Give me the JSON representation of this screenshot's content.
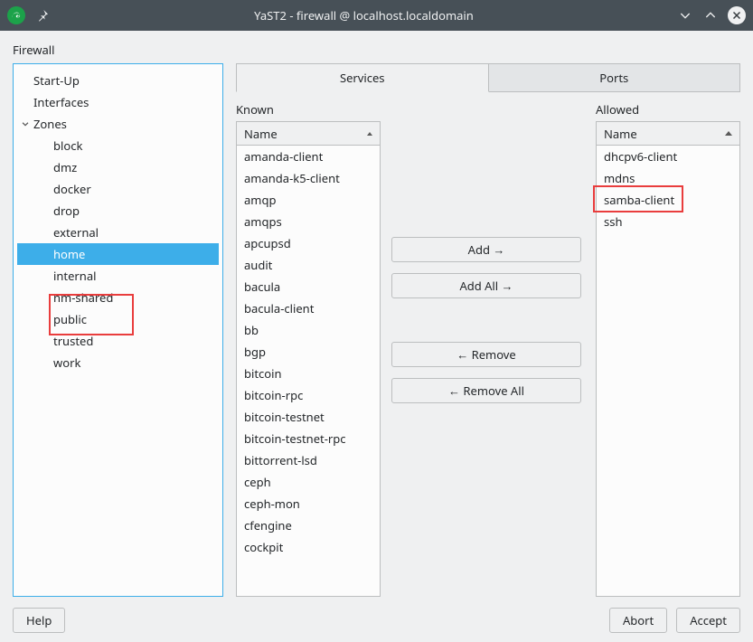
{
  "window": {
    "title": "YaST2 ‑ firewall @ localhost.localdomain"
  },
  "section_label": "Firewall",
  "tree": {
    "items": [
      {
        "label": "Start-Up",
        "level": 0
      },
      {
        "label": "Interfaces",
        "level": 0
      },
      {
        "label": "Zones",
        "level": 0,
        "expanded": true,
        "children": [
          {
            "label": "block"
          },
          {
            "label": "dmz"
          },
          {
            "label": "docker"
          },
          {
            "label": "drop"
          },
          {
            "label": "external"
          },
          {
            "label": "home",
            "selected": true
          },
          {
            "label": "internal"
          },
          {
            "label": "nm-shared"
          },
          {
            "label": "public"
          },
          {
            "label": "trusted"
          },
          {
            "label": "work"
          }
        ]
      }
    ]
  },
  "tabs": {
    "services": "Services",
    "ports": "Ports",
    "active": "services"
  },
  "known": {
    "label": "Known",
    "header": "Name",
    "items": [
      "amanda-client",
      "amanda-k5-client",
      "amqp",
      "amqps",
      "apcupsd",
      "audit",
      "bacula",
      "bacula-client",
      "bb",
      "bgp",
      "bitcoin",
      "bitcoin-rpc",
      "bitcoin-testnet",
      "bitcoin-testnet-rpc",
      "bittorrent-lsd",
      "ceph",
      "ceph-mon",
      "cfengine",
      "cockpit"
    ]
  },
  "allowed": {
    "label": "Allowed",
    "header": "Name",
    "items": [
      "dhcpv6-client",
      "mdns",
      "samba-client",
      "ssh"
    ]
  },
  "buttons": {
    "add": "Add →",
    "add_all": "Add All →",
    "remove": "← Remove",
    "remove_all": "← Remove All"
  },
  "footer": {
    "help": "Help",
    "abort": "Abort",
    "accept": "Accept"
  }
}
